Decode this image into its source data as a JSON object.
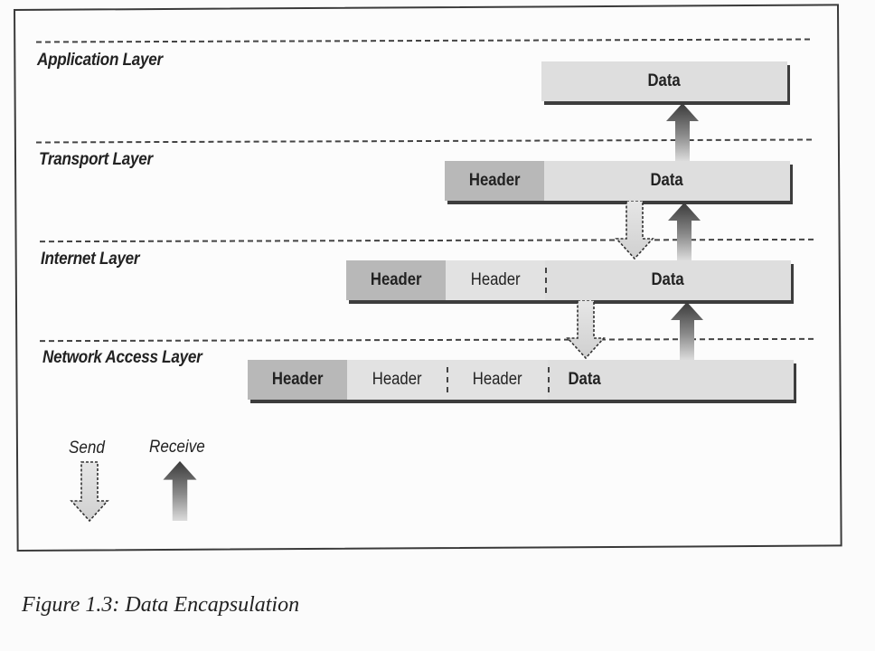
{
  "figure": {
    "caption": "Figure 1.3:  Data Encapsulation",
    "layers": [
      {
        "label": "Application Layer"
      },
      {
        "label": "Transport Layer"
      },
      {
        "label": "Internet Layer"
      },
      {
        "label": "Network Access Layer"
      }
    ],
    "packets": [
      {
        "layer": "Application Layer",
        "segments": [
          "Data"
        ]
      },
      {
        "layer": "Transport Layer",
        "segments": [
          "Header",
          "Data"
        ]
      },
      {
        "layer": "Internet Layer",
        "segments": [
          "Header",
          "Header",
          "Data"
        ]
      },
      {
        "layer": "Network Access Layer",
        "segments": [
          "Header",
          "Header",
          "Header",
          "Data"
        ]
      }
    ],
    "legend": {
      "send_label": "Send",
      "receive_label": "Receive"
    }
  }
}
